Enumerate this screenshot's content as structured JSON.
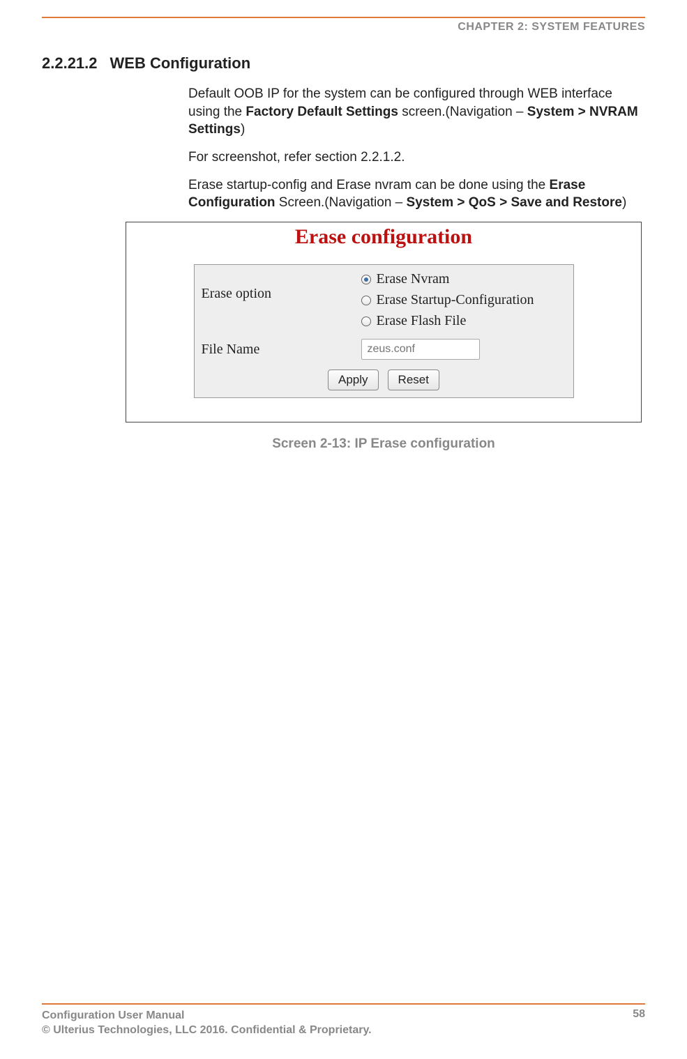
{
  "header": {
    "chapter": "CHAPTER 2: SYSTEM FEATURES"
  },
  "section": {
    "number": "2.2.21.2",
    "title": "WEB Configuration"
  },
  "para1": {
    "t1": "Default OOB IP for the system can be configured through WEB interface using the ",
    "b1": "Factory Default Settings",
    "t2": " screen.(Navigation – ",
    "b2": "System > NVRAM Settings",
    "t3": ")"
  },
  "para2": {
    "t": "For screenshot, refer section 2.2.1.2."
  },
  "para3": {
    "t1": "Erase startup-config and Erase nvram can be done using the ",
    "b1": "Erase Configuration",
    "t2": " Screen.(Navigation – ",
    "b2": "System > QoS > Save and Restore",
    "t3": ")"
  },
  "figure": {
    "title": "Erase configuration",
    "label_erase_option": "Erase option",
    "label_file_name": "File Name",
    "radio_nvram": "Erase Nvram",
    "radio_startup": "Erase Startup-Configuration",
    "radio_flash": "Erase Flash File",
    "file_placeholder": "zeus.conf",
    "apply": "Apply",
    "reset": "Reset",
    "caption": "Screen 2-13: IP Erase configuration",
    "selected_radio": "nvram"
  },
  "footer": {
    "line1": "Configuration User Manual",
    "line2": "© Ulterius Technologies, LLC 2016. Confidential & Proprietary.",
    "page": "58"
  }
}
